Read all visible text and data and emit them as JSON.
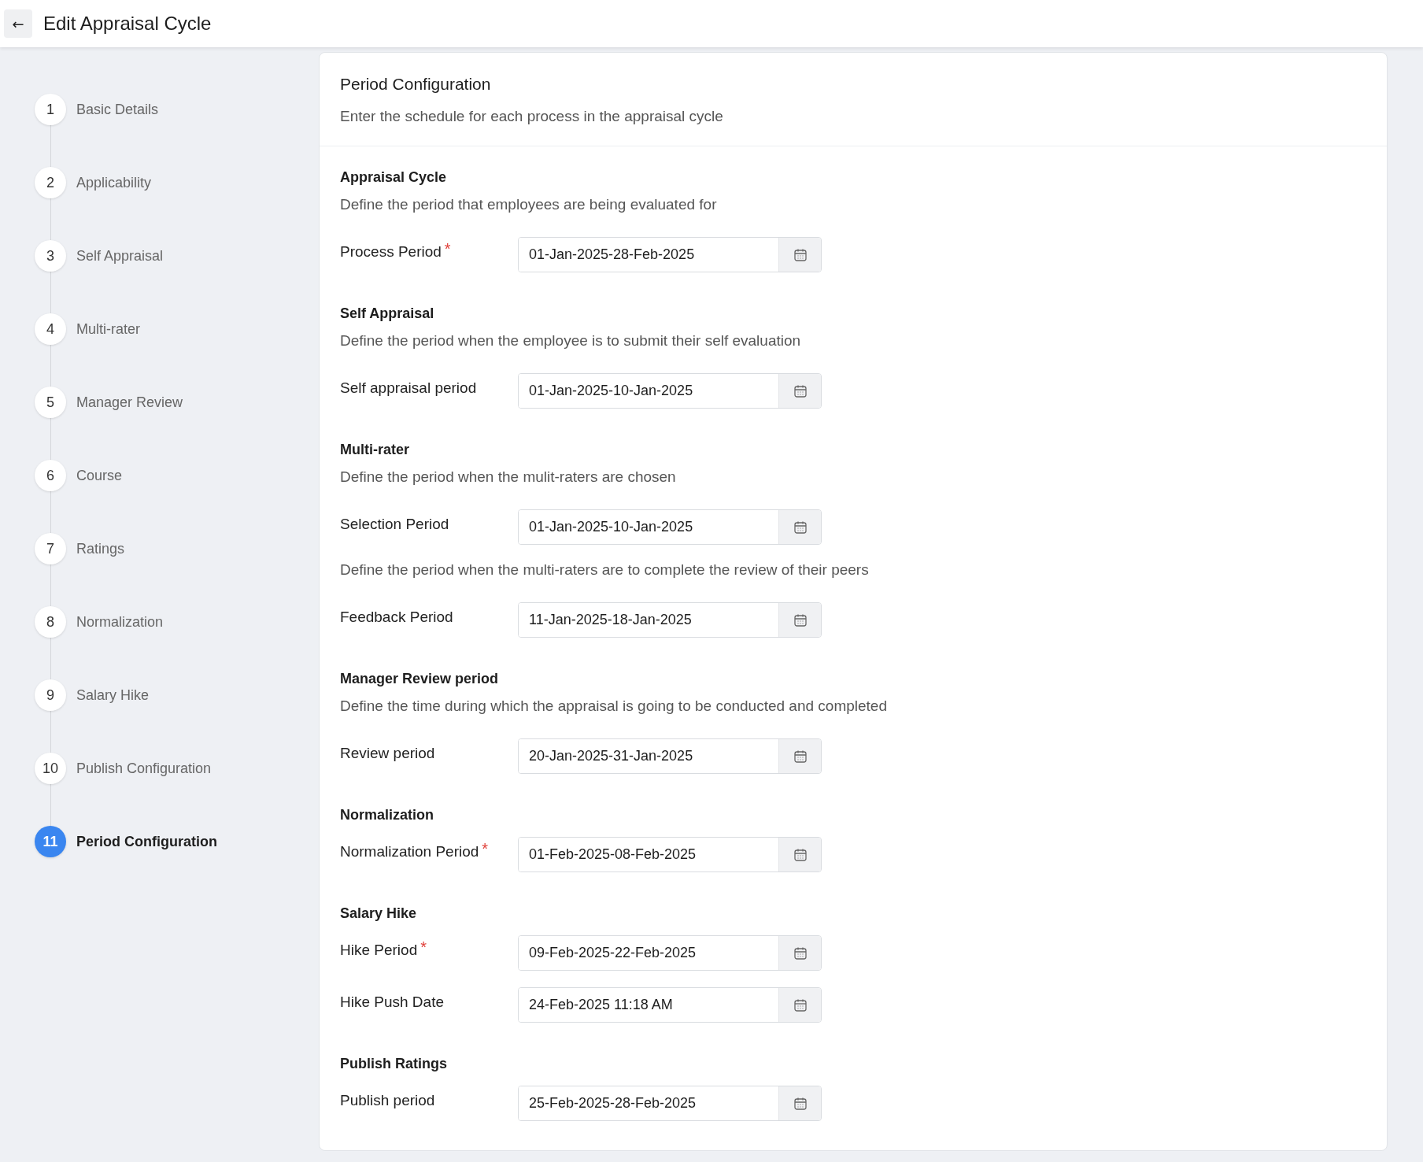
{
  "header": {
    "back_icon": "←",
    "title": "Edit Appraisal Cycle"
  },
  "steps": [
    {
      "number": "1",
      "label": "Basic Details",
      "selected": false
    },
    {
      "number": "2",
      "label": "Applicability",
      "selected": false
    },
    {
      "number": "3",
      "label": "Self Appraisal",
      "selected": false
    },
    {
      "number": "4",
      "label": "Multi-rater",
      "selected": false
    },
    {
      "number": "5",
      "label": "Manager Review",
      "selected": false
    },
    {
      "number": "6",
      "label": "Course",
      "selected": false
    },
    {
      "number": "7",
      "label": "Ratings",
      "selected": false
    },
    {
      "number": "8",
      "label": "Normalization",
      "selected": false
    },
    {
      "number": "9",
      "label": "Salary Hike",
      "selected": false
    },
    {
      "number": "10",
      "label": "Publish Configuration",
      "selected": false
    },
    {
      "number": "11",
      "label": "Period Configuration",
      "selected": true
    }
  ],
  "panel": {
    "title": "Period Configuration",
    "description": "Enter the schedule for each process in the appraisal cycle"
  },
  "sections": [
    {
      "title": "Appraisal Cycle",
      "items": [
        {
          "kind": "description",
          "text": "Define the period that employees are being evaluated for"
        },
        {
          "kind": "field",
          "label": "Process Period",
          "required_mark": "*",
          "value": "01-Jan-2025-28-Feb-2025"
        }
      ]
    },
    {
      "title": "Self Appraisal",
      "items": [
        {
          "kind": "description",
          "text": "Define the period when the employee is to submit their self evaluation"
        },
        {
          "kind": "field",
          "label": "Self appraisal period",
          "value": "01-Jan-2025-10-Jan-2025"
        }
      ]
    },
    {
      "title": "Multi-rater",
      "items": [
        {
          "kind": "description",
          "text": "Define the period when the mulit-raters are chosen"
        },
        {
          "kind": "field",
          "label": "Selection Period",
          "value": "01-Jan-2025-10-Jan-2025"
        },
        {
          "kind": "description",
          "text": "Define the period when the multi-raters are to complete the review of their peers"
        },
        {
          "kind": "field",
          "label": "Feedback Period",
          "value": "11-Jan-2025-18-Jan-2025"
        }
      ]
    },
    {
      "title": "Manager Review period",
      "items": [
        {
          "kind": "description",
          "text": "Define the time during which the appraisal is going to be conducted and completed"
        },
        {
          "kind": "field",
          "label": "Review period",
          "value": "20-Jan-2025-31-Jan-2025"
        }
      ]
    },
    {
      "title": "Normalization",
      "items": [
        {
          "kind": "field",
          "label": "Normalization Period",
          "required_mark": "*",
          "value": "01-Feb-2025-08-Feb-2025"
        }
      ]
    },
    {
      "title": "Salary Hike",
      "items": [
        {
          "kind": "field",
          "label": "Hike Period",
          "required_mark": "*",
          "value": "09-Feb-2025-22-Feb-2025"
        },
        {
          "kind": "field",
          "label": "Hike Push Date",
          "value": "24-Feb-2025 11:18 AM"
        }
      ]
    },
    {
      "title": "Publish Ratings",
      "items": [
        {
          "kind": "field",
          "label": "Publish period",
          "value": "25-Feb-2025-28-Feb-2025"
        }
      ]
    }
  ]
}
